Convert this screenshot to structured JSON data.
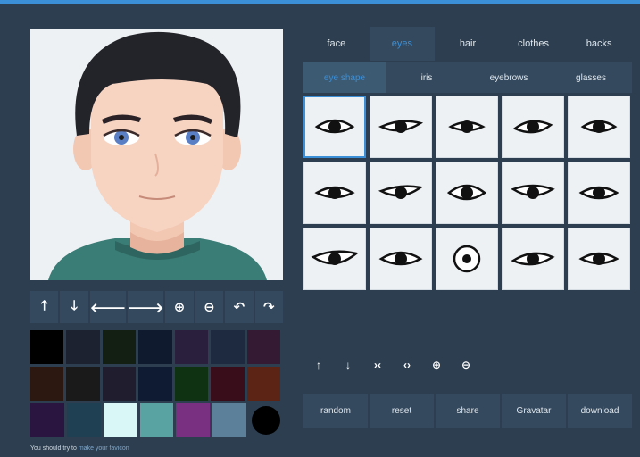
{
  "colors": {
    "background": "#2c3e50",
    "panel": "#34495e",
    "accent": "#3b8fd6",
    "cell_bg": "#eef1f4"
  },
  "preview": {
    "label": "avatar-preview"
  },
  "controls": [
    {
      "name": "move-up-icon",
      "glyph": "🡑"
    },
    {
      "name": "move-down-icon",
      "glyph": "🡓"
    },
    {
      "name": "move-left-icon",
      "glyph": "🡐"
    },
    {
      "name": "move-right-icon",
      "glyph": "🡒"
    },
    {
      "name": "zoom-in-icon",
      "glyph": "⊕"
    },
    {
      "name": "zoom-out-icon",
      "glyph": "⊖"
    },
    {
      "name": "rotate-left-icon",
      "glyph": "↶"
    },
    {
      "name": "rotate-right-icon",
      "glyph": "↷"
    }
  ],
  "palette": [
    [
      "#000000",
      "#1c2230",
      "#141f14",
      "#101a2e",
      "#2a1f3d",
      "#1e2a40",
      "#341a33"
    ],
    [
      "#2c1810",
      "#1a1a1a",
      "#1f1d2e",
      "#0f1a33",
      "#0f3312",
      "#3a0d1a",
      "#5c2414"
    ],
    [
      "#2a1440",
      "#1f4052",
      "#d9f7f7",
      "#5aa3a3",
      "#7a3080",
      "#5c8099",
      "#000000"
    ]
  ],
  "hint": {
    "text": "You should try to ",
    "link": "make your favicon"
  },
  "tabs": [
    {
      "label": "face",
      "active": false
    },
    {
      "label": "eyes",
      "active": true
    },
    {
      "label": "hair",
      "active": false
    },
    {
      "label": "clothes",
      "active": false
    },
    {
      "label": "backs",
      "active": false
    }
  ],
  "subtabs": [
    {
      "label": "eye shape",
      "active": true
    },
    {
      "label": "iris",
      "active": false
    },
    {
      "label": "eyebrows",
      "active": false
    },
    {
      "label": "glasses",
      "active": false
    }
  ],
  "eye_shapes": [
    {
      "id": 1,
      "selected": true
    },
    {
      "id": 2,
      "selected": false
    },
    {
      "id": 3,
      "selected": false
    },
    {
      "id": 4,
      "selected": false
    },
    {
      "id": 5,
      "selected": false
    },
    {
      "id": 6,
      "selected": false
    },
    {
      "id": 7,
      "selected": false
    },
    {
      "id": 8,
      "selected": false
    },
    {
      "id": 9,
      "selected": false
    },
    {
      "id": 10,
      "selected": false
    },
    {
      "id": 11,
      "selected": false
    },
    {
      "id": 12,
      "selected": false
    },
    {
      "id": 13,
      "selected": false
    },
    {
      "id": 14,
      "selected": false
    },
    {
      "id": 15,
      "selected": false
    }
  ],
  "position_tools": [
    {
      "name": "move-up-icon",
      "glyph": "↑"
    },
    {
      "name": "move-down-icon",
      "glyph": "↓"
    },
    {
      "name": "narrow-icon",
      "glyph": "›‹"
    },
    {
      "name": "widen-icon",
      "glyph": "‹›"
    },
    {
      "name": "zoom-in-icon",
      "glyph": "⊕"
    },
    {
      "name": "zoom-out-icon",
      "glyph": "⊖"
    }
  ],
  "actions": [
    {
      "label": "random"
    },
    {
      "label": "reset"
    },
    {
      "label": "share"
    },
    {
      "label": "Gravatar"
    },
    {
      "label": "download"
    }
  ]
}
